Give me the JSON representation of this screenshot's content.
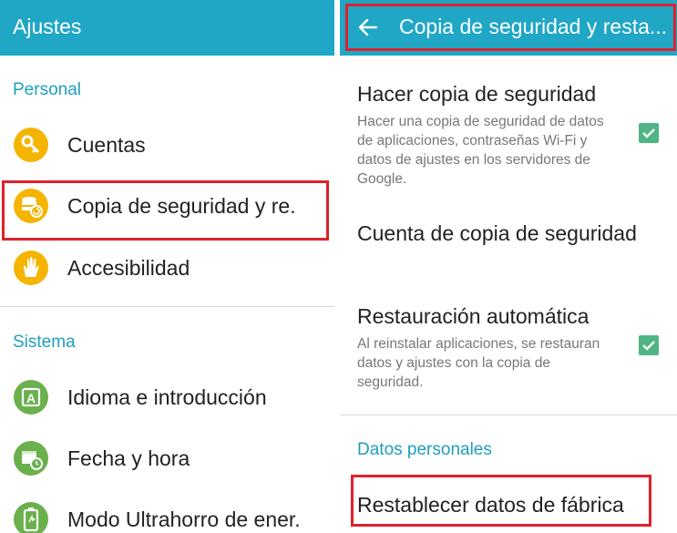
{
  "left": {
    "appbar_title": "Ajustes",
    "sections": [
      {
        "header": "Personal",
        "items": [
          {
            "label": "Cuentas",
            "icon": "key-icon",
            "color": "#f5b400"
          },
          {
            "label": "Copia de seguridad y re.",
            "icon": "backup-database-icon",
            "color": "#f5b400",
            "highlighted": true
          },
          {
            "label": "Accesibilidad",
            "icon": "hand-icon",
            "color": "#f5b400"
          }
        ]
      },
      {
        "header": "Sistema",
        "items": [
          {
            "label": "Idioma e introducción",
            "icon": "language-a-icon",
            "color": "#6ab04c"
          },
          {
            "label": "Fecha y hora",
            "icon": "calendar-clock-icon",
            "color": "#6ab04c"
          },
          {
            "label": "Modo Ultrahorro de ener.",
            "icon": "battery-saver-icon",
            "color": "#6ab04c"
          }
        ]
      }
    ]
  },
  "right": {
    "appbar_title": "Copia de seguridad y resta...",
    "prefs": [
      {
        "title": "Hacer copia de seguridad",
        "summary": "Hacer una copia de seguridad de datos de aplicaciones, contraseñas Wi-Fi y datos de ajustes en los servidores de Google.",
        "checked": true
      },
      {
        "title": "Cuenta de copia de seguridad",
        "summary": ""
      },
      {
        "title": "Restauración automática",
        "summary": "Al reinstalar aplicaciones, se restauran datos y ajustes con la copia de seguridad.",
        "checked": true
      }
    ],
    "section_header": "Datos personales",
    "factory_reset": "Restablecer datos de fábrica"
  },
  "colors": {
    "appbar": "#1fa7c5",
    "accent_text": "#1f9fbd",
    "highlight": "#e0212b",
    "checkbox": "#4fb584"
  }
}
